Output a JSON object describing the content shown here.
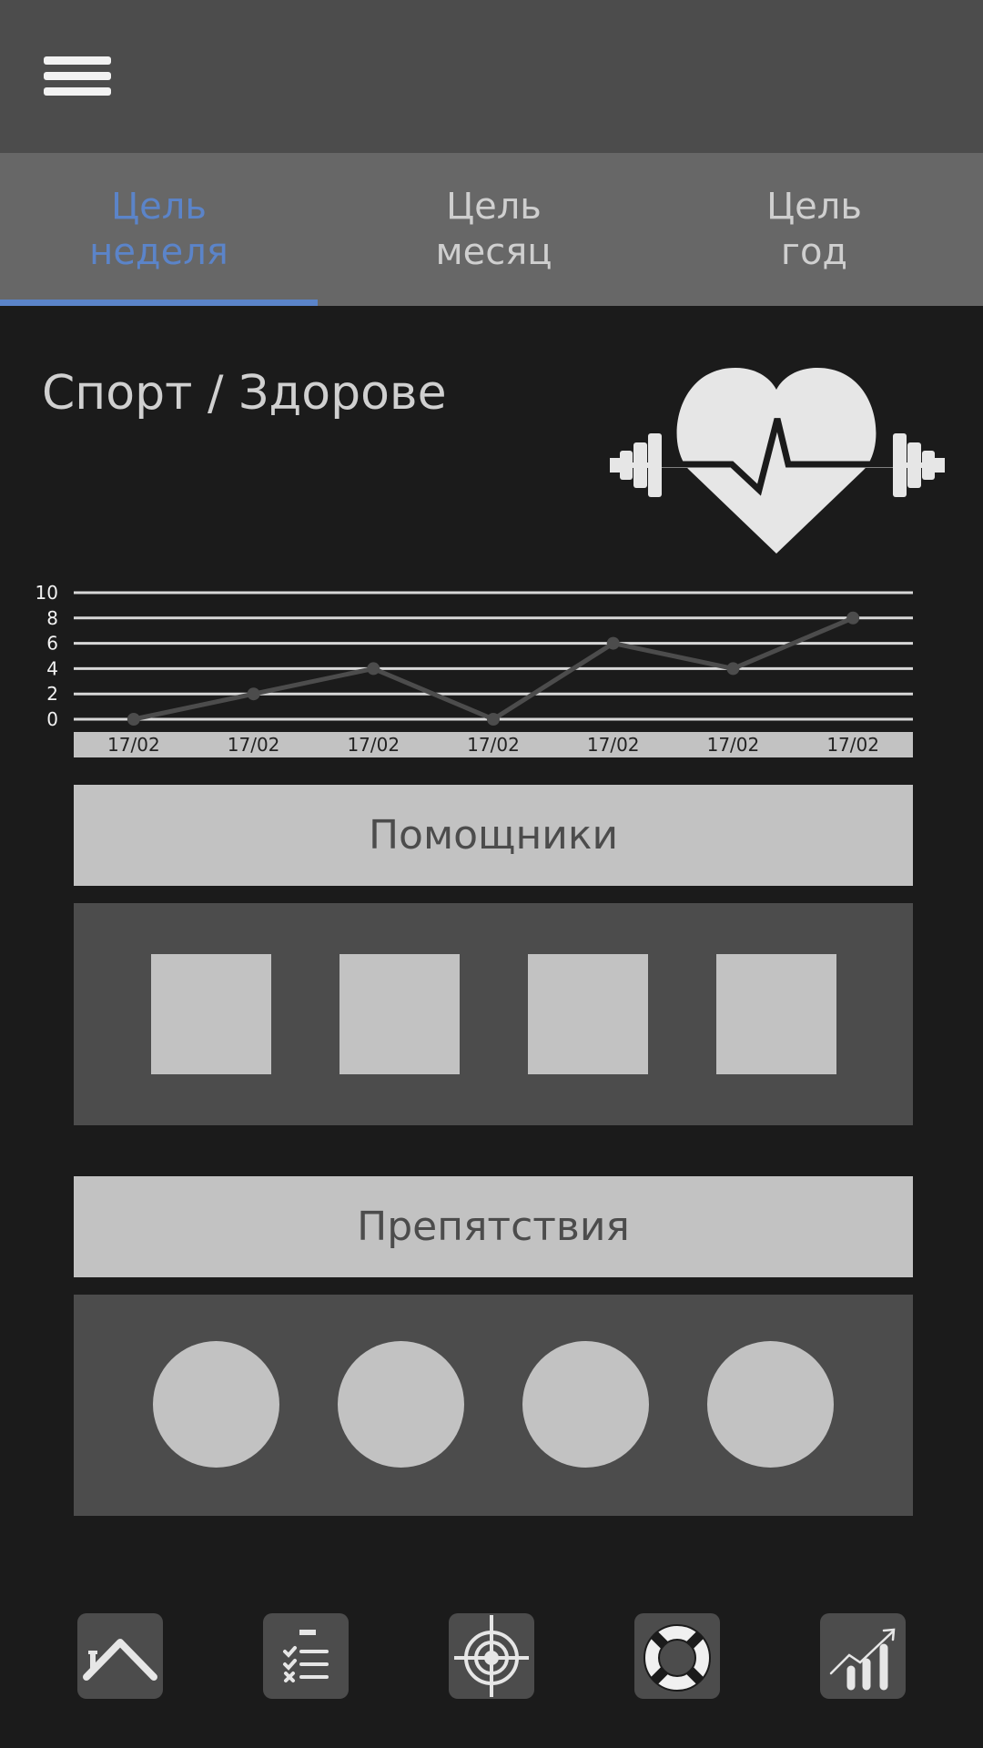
{
  "tabs": [
    {
      "line1": "Цель",
      "line2": "неделя",
      "active": true
    },
    {
      "line1": "Цель",
      "line2": "месяц",
      "active": false
    },
    {
      "line1": "Цель",
      "line2": "год",
      "active": false
    }
  ],
  "section": {
    "title": "Спорт / Здорове"
  },
  "colors": {
    "accent": "#5b84c9",
    "topbar": "#4c4c4c",
    "tabs_bg": "#676767",
    "background": "#1b1b1b",
    "light": "#c2c2c2"
  },
  "chart_data": {
    "type": "line",
    "categories": [
      "17/02",
      "17/02",
      "17/02",
      "17/02",
      "17/02",
      "17/02",
      "17/02"
    ],
    "values": [
      0,
      2,
      4,
      0,
      6,
      4,
      8
    ],
    "y_ticks": [
      "10",
      "8",
      "6",
      "4",
      "2",
      "0"
    ],
    "ylim": [
      0,
      10
    ],
    "grid": true
  },
  "helpers": {
    "title": "Помощники",
    "items": 4
  },
  "obstacles": {
    "title": "Препятствия",
    "items": 4
  },
  "bottom_nav": [
    "home-icon",
    "checklist-icon",
    "target-icon",
    "lifebuoy-icon",
    "growth-chart-icon"
  ]
}
